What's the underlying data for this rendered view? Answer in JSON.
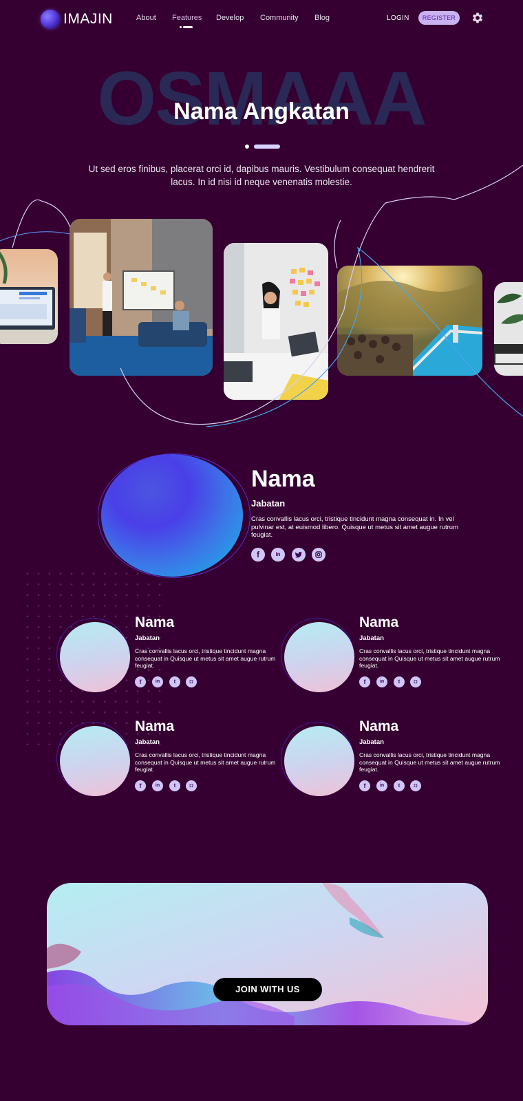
{
  "nav": {
    "brand": "IMAJIN",
    "links": [
      "About",
      "Features",
      "Develop",
      "Community",
      "Blog"
    ],
    "active_link": "Features",
    "login": "LOGIN",
    "register": "REGISTER"
  },
  "hero": {
    "background_word": "OSMAAA",
    "title": "Nama Angkatan",
    "description": "Ut sed eros finibus, placerat orci id, dapibus mauris. Vestibulum consequat hendrerit lacus. In id nisi id neque venenatis molestie."
  },
  "gallery": {
    "photos": [
      "laptop-desk",
      "team-presentation",
      "sticky-notes-wall",
      "pool-party",
      "plant-laptop"
    ]
  },
  "featured": {
    "name": "Nama",
    "role": "Jabatan",
    "description": "Cras convallis lacus orci, tristique tincidunt magna consequat in. In vel pulvinar est, at euismod libero. Quisque ut metus sit amet augue rutrum feugiat.",
    "social": [
      "facebook-icon",
      "linkedin-icon",
      "twitter-icon",
      "instagram-icon"
    ]
  },
  "members": [
    {
      "name": "Nama",
      "role": "Jabatan",
      "description": "Cras convallis lacus orci, tristique tincidunt magna consequat in Quisque ut metus sit amet augue rutrum feugiat."
    },
    {
      "name": "Nama",
      "role": "Jabatan",
      "description": "Cras convallis lacus orci, tristique tincidunt magna consequat in Quisque ut metus sit amet augue rutrum feugiat."
    },
    {
      "name": "Nama",
      "role": "Jabatan",
      "description": "Cras convallis lacus orci, tristique tincidunt magna consequat in Quisque ut metus sit amet augue rutrum feugiat."
    },
    {
      "name": "Nama",
      "role": "Jabatan",
      "description": "Cras convallis lacus orci, tristique tincidunt magna consequat in Quisque ut metus sit amet augue rutrum feugiat."
    }
  ],
  "cta": {
    "button": "JOIN WITH US"
  },
  "colors": {
    "background": "#350031",
    "accent": "#c9b2f0",
    "register_text": "#5a2ab0"
  }
}
